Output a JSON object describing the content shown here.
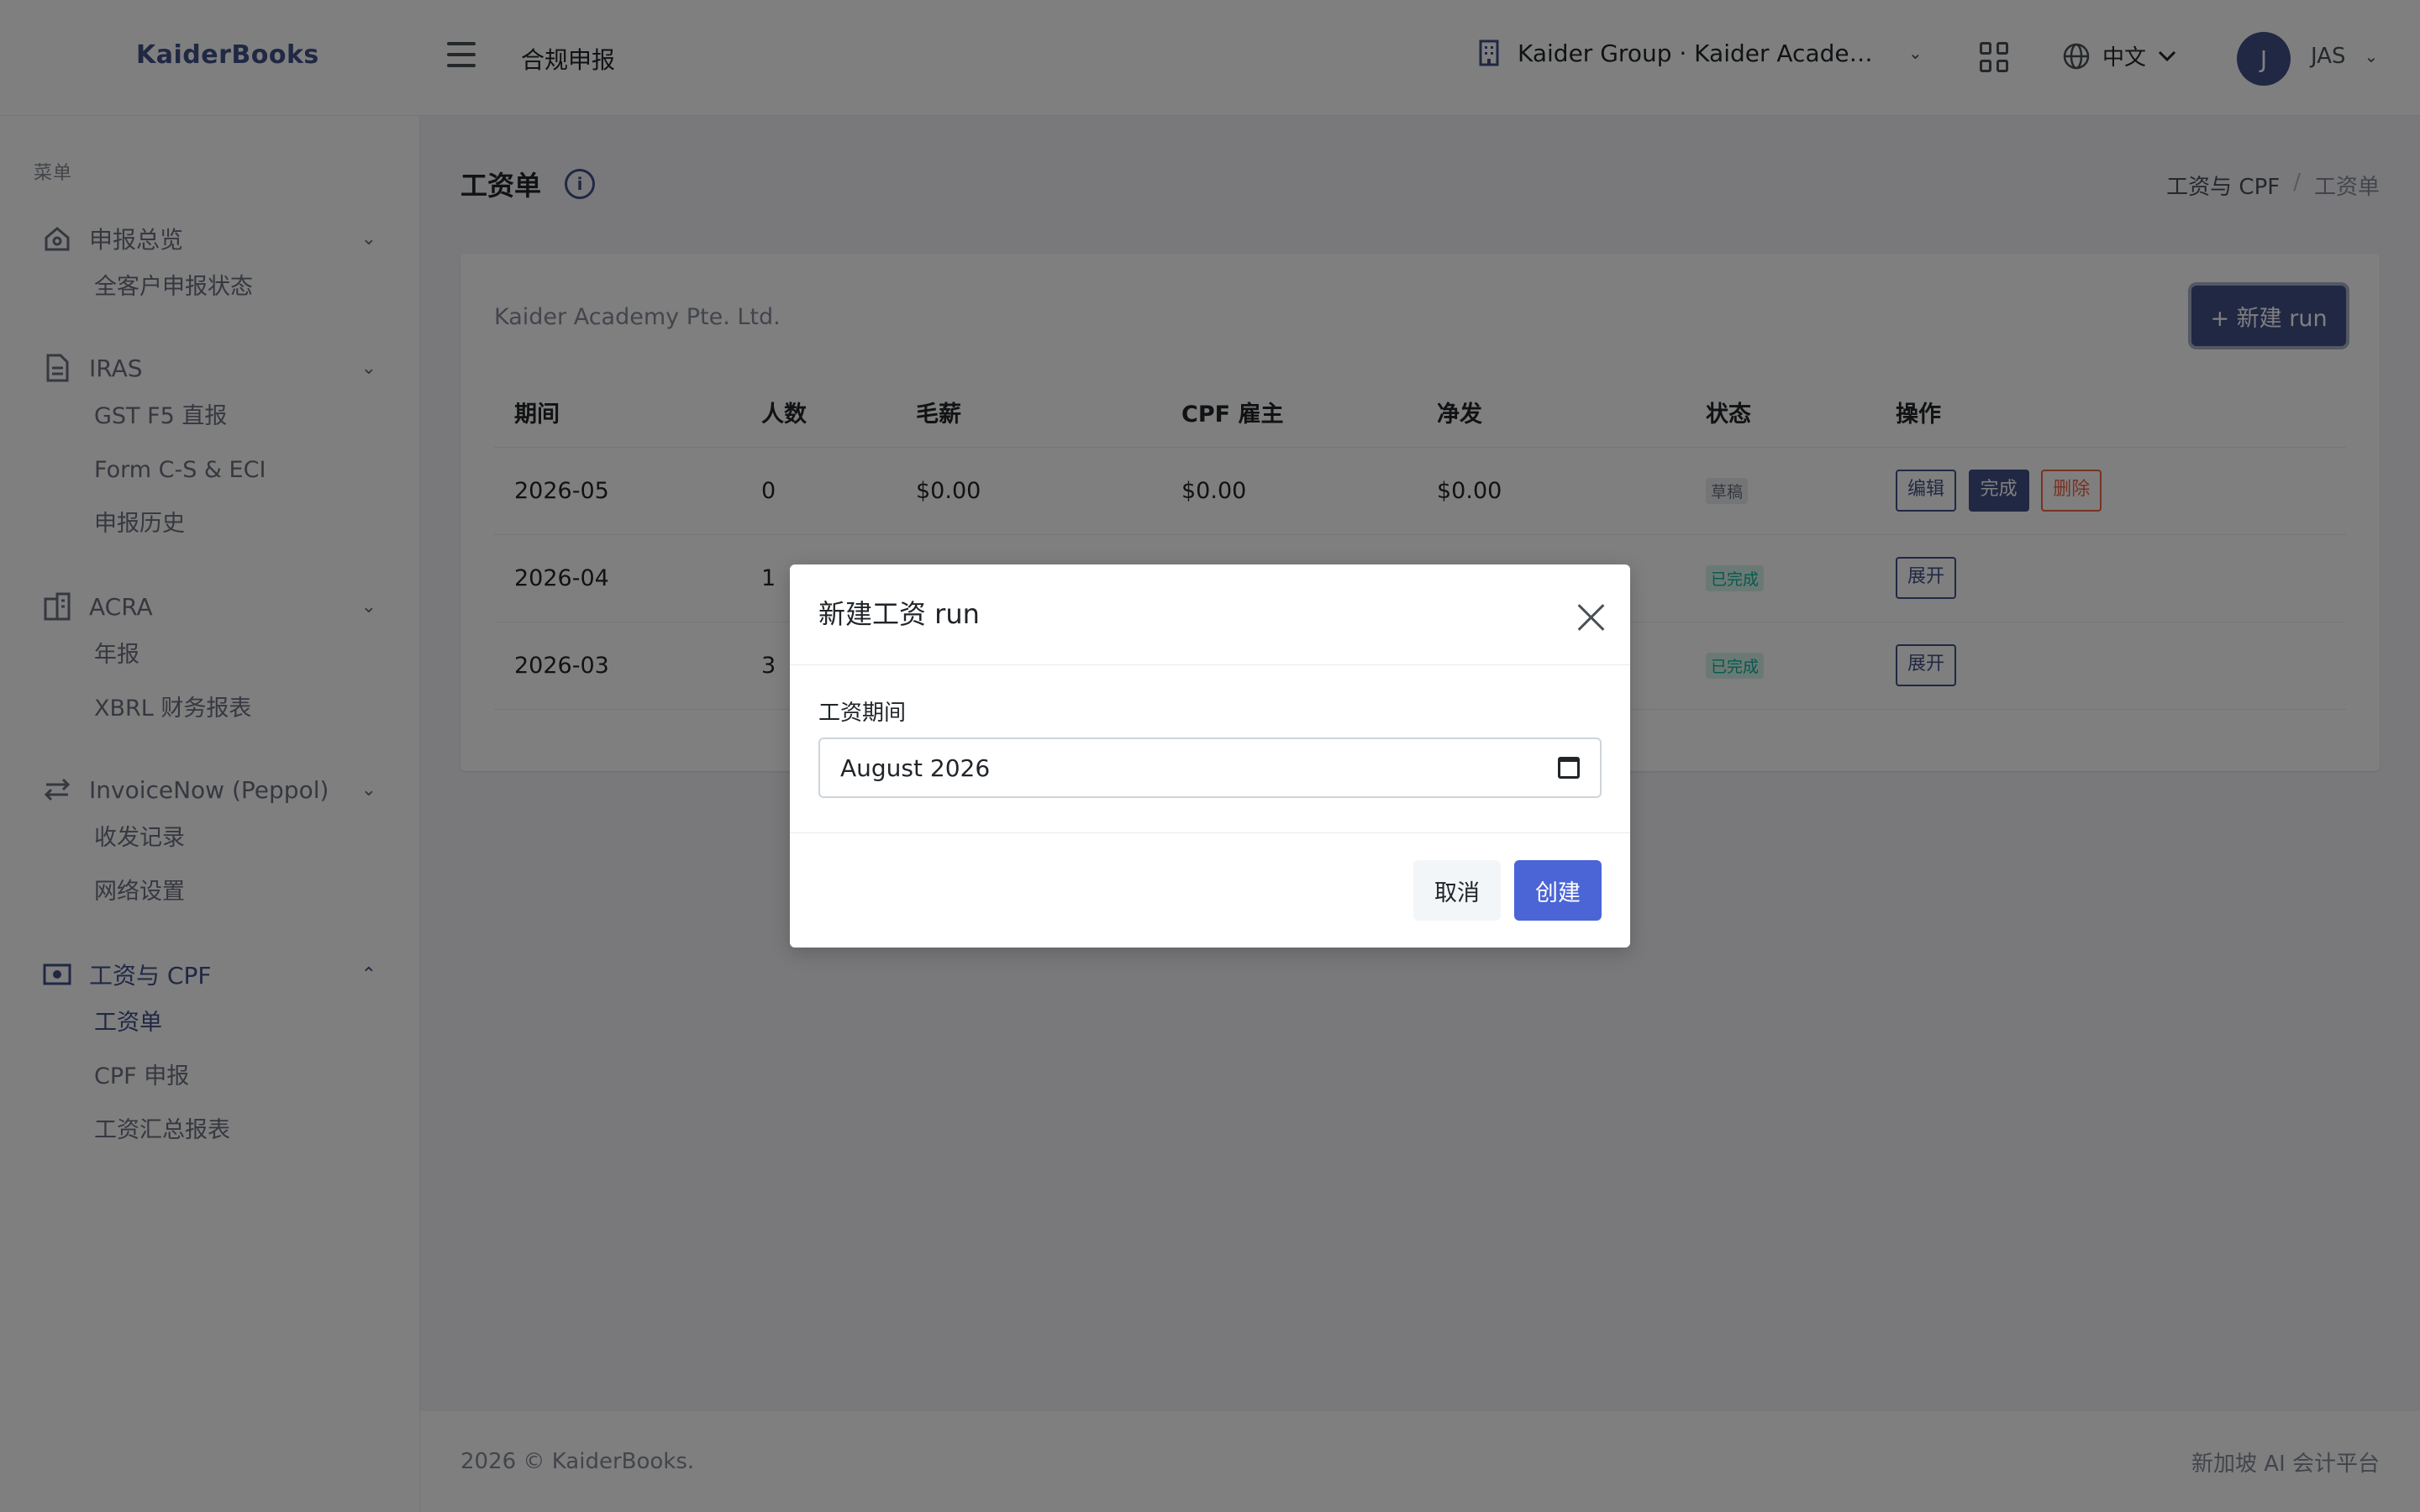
{
  "app": {
    "logo": "KaiderBooks",
    "top_title": "合规申报"
  },
  "header": {
    "org": "Kaider Group · Kaider Academy ...",
    "language": "中文",
    "avatar_initial": "J",
    "user": "JAS"
  },
  "sidebar": {
    "menu_title": "菜单",
    "groups": [
      {
        "label": "申报总览",
        "icon": "home-icon",
        "items": [
          {
            "label": "全客户申报状态"
          }
        ]
      },
      {
        "label": "IRAS",
        "icon": "document-icon",
        "items": [
          {
            "label": "GST F5 直报"
          },
          {
            "label": "Form C-S & ECI"
          },
          {
            "label": "申报历史"
          }
        ]
      },
      {
        "label": "ACRA",
        "icon": "building-icon",
        "items": [
          {
            "label": "年报"
          },
          {
            "label": "XBRL 财务报表"
          }
        ]
      },
      {
        "label": "InvoiceNow (Peppol)",
        "icon": "exchange-icon",
        "items": [
          {
            "label": "收发记录"
          },
          {
            "label": "网络设置"
          }
        ]
      },
      {
        "label": "工资与 CPF",
        "icon": "money-icon",
        "items": [
          {
            "label": "工资单"
          },
          {
            "label": "CPF 申报"
          },
          {
            "label": "工资汇总报表"
          }
        ]
      }
    ]
  },
  "page": {
    "title": "工资单",
    "breadcrumb": [
      "工资与 CPF",
      "工资单"
    ],
    "company": "Kaider Academy Pte. Ltd.",
    "new_run_label": "+ 新建 run"
  },
  "table": {
    "headers": [
      "期间",
      "人数",
      "毛薪",
      "CPF 雇主",
      "净发",
      "状态",
      "操作"
    ],
    "rows": [
      {
        "period": "2026-05",
        "count": "0",
        "gross": "$0.00",
        "cpf": "$0.00",
        "net": "$0.00",
        "status": "草稿",
        "actions": [
          "编辑",
          "完成",
          "删除"
        ]
      },
      {
        "period": "2026-04",
        "count": "1",
        "gross": "",
        "cpf": "",
        "net": "",
        "status": "已完成",
        "actions": [
          "展开"
        ]
      },
      {
        "period": "2026-03",
        "count": "3",
        "gross": "",
        "cpf": "",
        "net": "",
        "status": "已完成",
        "actions": [
          "展开"
        ]
      }
    ]
  },
  "modal": {
    "title": "新建工资 run",
    "field_label": "工资期间",
    "field_value": "August 2026",
    "cancel": "取消",
    "create": "创建"
  },
  "footer": {
    "left": "2026 © KaiderBooks.",
    "right": "新加坡 AI 会计平台"
  },
  "colors": {
    "primary": "#405189",
    "create_button": "#4b65d6",
    "success": "#0ab39c",
    "danger": "#f06548"
  }
}
